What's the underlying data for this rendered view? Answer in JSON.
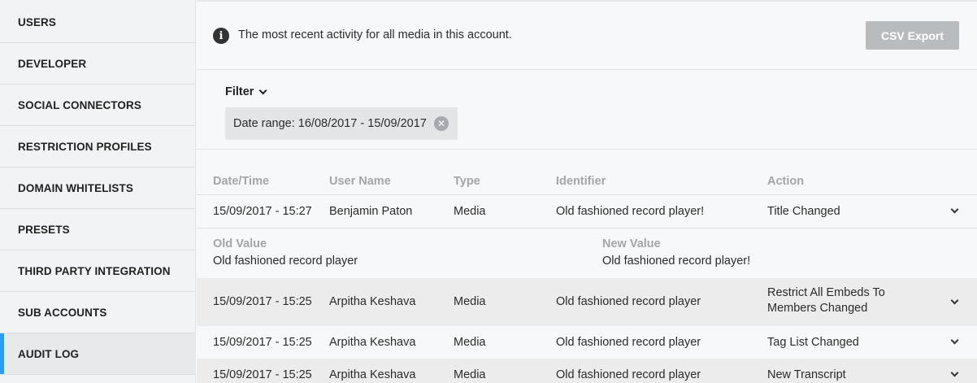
{
  "sidebar": {
    "items": [
      {
        "label": "USERS"
      },
      {
        "label": "DEVELOPER"
      },
      {
        "label": "SOCIAL CONNECTORS"
      },
      {
        "label": "RESTRICTION PROFILES"
      },
      {
        "label": "DOMAIN WHITELISTS"
      },
      {
        "label": "PRESETS"
      },
      {
        "label": "THIRD PARTY INTEGRATION"
      },
      {
        "label": "SUB ACCOUNTS"
      },
      {
        "label": "AUDIT LOG",
        "active": true
      }
    ]
  },
  "header": {
    "info_text": "The most recent activity for all media in this account.",
    "csv_button": "CSV Export"
  },
  "filter": {
    "label": "Filter",
    "chip": "Date range: 16/08/2017 - 15/09/2017"
  },
  "table": {
    "columns": [
      "Date/Time",
      "User Name",
      "Type",
      "Identifier",
      "Action"
    ],
    "rows": [
      {
        "datetime": "15/09/2017 - 15:27",
        "user": "Benjamin Paton",
        "type": "Media",
        "identifier": "Old fashioned record player!",
        "action": "Title Changed",
        "expanded": true
      },
      {
        "datetime": "15/09/2017 - 15:25",
        "user": "Arpitha Keshava",
        "type": "Media",
        "identifier": "Old fashioned record player",
        "action_line1": "Restrict All Embeds To",
        "action_line2": "Members Changed"
      },
      {
        "datetime": "15/09/2017 - 15:25",
        "user": "Arpitha Keshava",
        "type": "Media",
        "identifier": "Old fashioned record player",
        "action": "Tag List Changed"
      },
      {
        "datetime": "15/09/2017 - 15:25",
        "user": "Arpitha Keshava",
        "type": "Media",
        "identifier": "Old fashioned record player",
        "action": "New Transcript"
      }
    ],
    "detail": {
      "old_label": "Old Value",
      "old_value": "Old fashioned record player",
      "new_label": "New Value",
      "new_value": "Old fashioned record player!"
    }
  },
  "colors": {
    "accent": "#2f9bf3",
    "csv_button_bg": "#b9bcbf"
  }
}
